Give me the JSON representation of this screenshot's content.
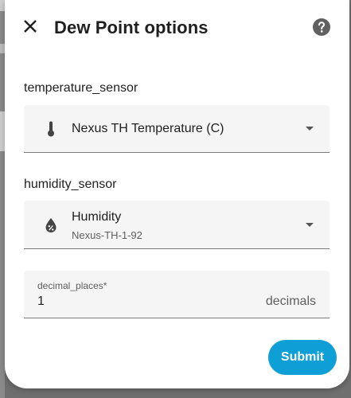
{
  "dialog": {
    "title": "Dew Point options",
    "close_icon": "close-icon",
    "help_icon": "help-circle-icon"
  },
  "fields": {
    "temperature_sensor": {
      "label": "temperature_sensor",
      "icon": "thermometer-icon",
      "selected": "Nexus TH Temperature (C)"
    },
    "humidity_sensor": {
      "label": "humidity_sensor",
      "icon": "water-percent-icon",
      "selected": "Humidity",
      "selected_secondary": "Nexus-TH-1-92"
    },
    "decimal_places": {
      "label": "decimal_places*",
      "value": "1",
      "suffix": "decimals"
    }
  },
  "actions": {
    "submit_label": "Submit"
  },
  "colors": {
    "accent": "#0d9fd6",
    "field_bg": "#f5f5f5",
    "text_primary": "#212121",
    "text_secondary": "#5f5f5f"
  }
}
